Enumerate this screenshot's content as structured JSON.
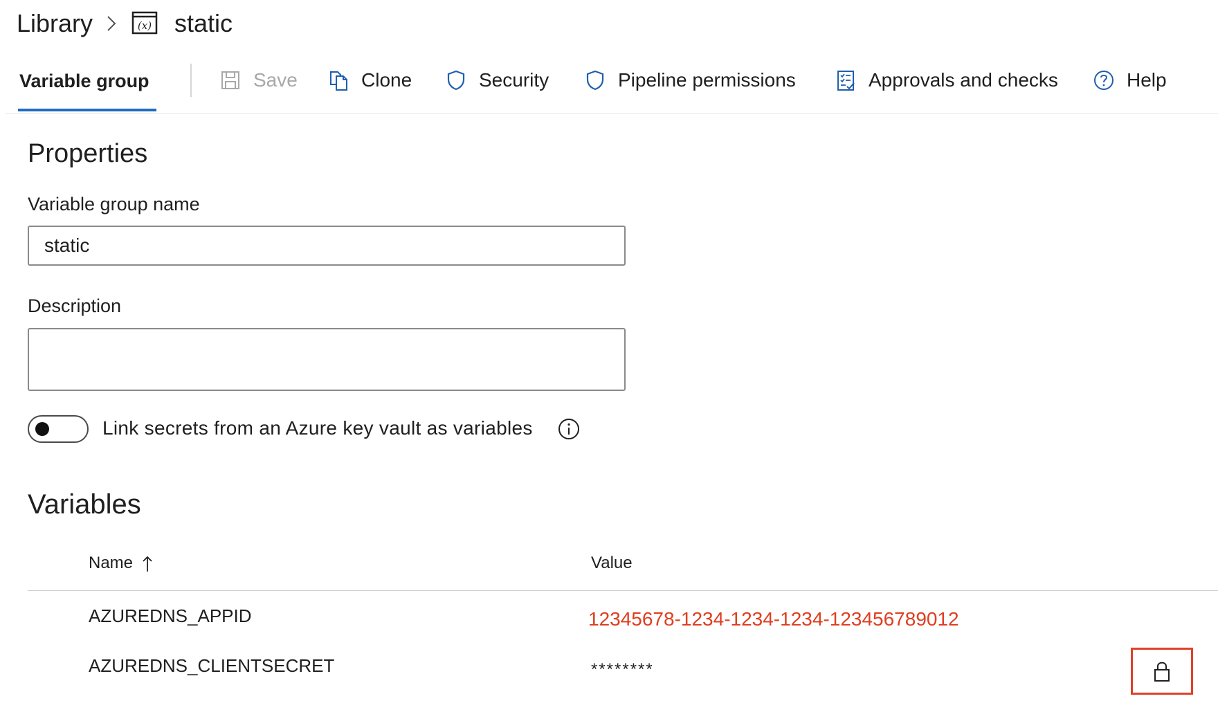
{
  "breadcrumb": {
    "root": "Library",
    "current": "static"
  },
  "icons": {
    "breadcrumb_separator": "chevron-right-icon",
    "variable_group": "variable-group-icon",
    "save": "save-icon",
    "clone": "clone-icon",
    "security": "shield-icon",
    "pipeline_permissions": "shield-icon",
    "approvals": "checklist-icon",
    "help": "help-icon",
    "info": "info-icon",
    "sort": "sort-ascending-icon",
    "lock": "lock-icon"
  },
  "toolbar": {
    "active_tab": "Variable group",
    "save_label": "Save",
    "clone_label": "Clone",
    "security_label": "Security",
    "pipeline_permissions_label": "Pipeline permissions",
    "approvals_label": "Approvals and checks",
    "help_label": "Help"
  },
  "properties": {
    "heading": "Properties",
    "name_label": "Variable group name",
    "name_value": "static",
    "description_label": "Description",
    "description_value": "",
    "keyvault_toggle_label": "Link secrets from an Azure key vault as variables",
    "keyvault_toggle_on": false
  },
  "variables": {
    "heading": "Variables",
    "columns": {
      "name": "Name",
      "value": "Value"
    },
    "rows": [
      {
        "name": "AZUREDNS_APPID",
        "value": "12345678-1234-1234-1234-123456789012",
        "secret": false
      },
      {
        "name": "AZUREDNS_CLIENTSECRET",
        "value": "********",
        "secret": true
      }
    ]
  },
  "colors": {
    "accent": "#1f6bc1",
    "icon_blue": "#1f5fae",
    "disabled": "#a8a8a8",
    "value_highlight": "#e03e1f",
    "lock_highlight_border": "#e0402a"
  }
}
